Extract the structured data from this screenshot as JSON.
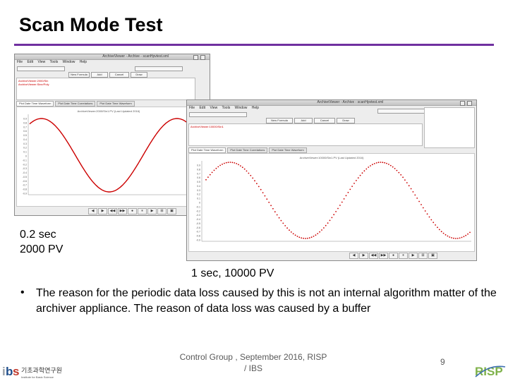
{
  "slide": {
    "title": "Scan Mode Test",
    "caption_left_line1": "0.2 sec",
    "caption_left_line2": "2000 PV",
    "caption_right": "1 sec, 10000 PV",
    "bullet_marker": "•",
    "bullet": "The reason for the periodic data loss caused by this is not an internal algorithm matter of the archiver appliance. The reason of data loss was caused by a buffer",
    "footer_line1": "Control Group , September 2016, RISP",
    "footer_line2": "/ IBS",
    "page_number": "9",
    "logo_ibs_text": "기초과학연구원",
    "logo_ibs_sub": "Institute for Basic Science",
    "logo_risp_text": "RISP"
  },
  "colors": {
    "title_rule": "#7030a0",
    "sine_line": "#cc0000",
    "sine_dots": "#cc0000",
    "footer_text": "#595959"
  },
  "screenshot_left": {
    "window_title": "ArchiveViewer - Archive - scanHpvtest.xml",
    "menu": [
      "File",
      "Edit",
      "View",
      "Tools",
      "Window",
      "Help"
    ],
    "buttons": [
      "New Formula",
      "Add",
      "Cancel",
      "Draw"
    ],
    "red_items": [
      "ArchiveViewer:2000/Sin",
      "ArchiveViewer:Sine/Poly"
    ],
    "tabs": [
      "Plot Date Time Waveform",
      "Plot Date Time Correlations",
      "Plot Date Time Waveform"
    ],
    "plot_title": "ArchiveViewer:2000/Sin1.PV (Last Updated 2016)",
    "y_ticks": [
      "0.9",
      "0.8",
      "0.7",
      "0.6",
      "0.5",
      "0.4",
      "0.3",
      "0.2",
      "0.1",
      "0",
      "-0.1",
      "-0.2",
      "-0.3",
      "-0.4",
      "-0.5",
      "-0.6",
      "-0.7",
      "-0.8",
      "-0.9"
    ],
    "nav_icons": [
      "◀",
      "▶",
      "◀◀",
      "▶▶",
      "●",
      "⏸",
      "▶",
      "⊞",
      "▣"
    ]
  },
  "screenshot_right": {
    "window_title": "ArchiveViewer - Archive - scanHpvtest.xml",
    "menu": [
      "File",
      "Edit",
      "View",
      "Tools",
      "Window",
      "Help"
    ],
    "buttons": [
      "New Formula",
      "Add",
      "Cancel",
      "Draw"
    ],
    "red_items": [
      "ArchiveViewer:10000/Sin1"
    ],
    "tabs": [
      "Plot Date Time Waveform",
      "Plot Date Time Correlations",
      "Plot Date Time Waveform"
    ],
    "plot_title": "ArchiveViewer:10000/Sin1.PV (Last Updated 2016)",
    "y_ticks": [
      "0.9",
      "0.8",
      "0.7",
      "0.6",
      "0.5",
      "0.4",
      "0.3",
      "0.2",
      "0.1",
      "0",
      "-0.1",
      "-0.2",
      "-0.3",
      "-0.4",
      "-0.5",
      "-0.6",
      "-0.7",
      "-0.8",
      "-0.9"
    ],
    "nav_icons": [
      "◀",
      "▶",
      "◀◀",
      "▶▶",
      "●",
      "⏸",
      "▶",
      "⊞",
      "▣"
    ]
  }
}
